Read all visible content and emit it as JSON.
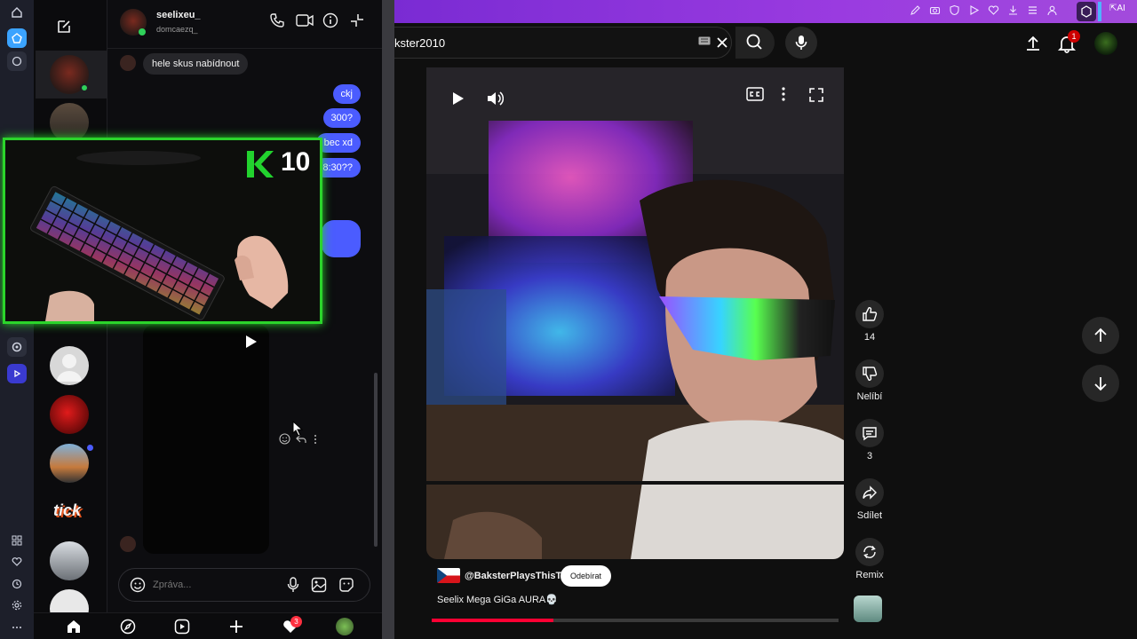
{
  "instagram": {
    "header": {
      "username": "seelixeu_",
      "handle": "domcaezq_"
    },
    "messages": {
      "incoming_1": "hele skus nabídnout",
      "out_1": "ckj",
      "out_2": "300?",
      "out_3": "bec xd",
      "out_4": "8:30??"
    },
    "composer": {
      "placeholder": "Zpráva..."
    },
    "nav": {
      "notification_count": "3"
    }
  },
  "webcam": {
    "counter": "10"
  },
  "browser": {
    "search_value": "kster2010",
    "notification_count": "1"
  },
  "short": {
    "channel": "@BaksterPlaysThisTv",
    "subscribe_label": "Odebírat",
    "title": "Seelix Mega GiGa AURA💀",
    "progress": 0.3,
    "actions": {
      "like_count": "14",
      "dislike_label": "Nelíbí",
      "comment_count": "3",
      "share_label": "Sdílet",
      "remix_label": "Remix"
    }
  },
  "colors": {
    "accent_purple": "#8a35da",
    "ig_blue": "#4b5cff",
    "yt_red": "#ff0033",
    "cam_green": "#2bd42b"
  }
}
